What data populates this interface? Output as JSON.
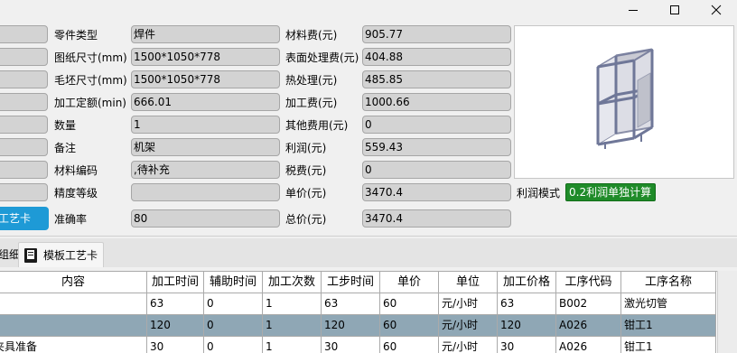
{
  "window": {
    "minimize_glyph": "minimize",
    "maximize_glyph": "maximize",
    "close_glyph": "close"
  },
  "form": {
    "left_labels": [
      "零件类型",
      "图纸尺寸(mm)",
      "毛坯尺寸(mm)",
      "加工定额(min)",
      "数量",
      "备注",
      "材料编码",
      "精度等级",
      "准确率"
    ],
    "left_values": [
      "焊件",
      "1500*1050*778",
      "1500*1050*778",
      "666.01",
      "1",
      "机架",
      ",待补充",
      "",
      "80"
    ],
    "right_labels": [
      "材料费(元)",
      "表面处理费(元)",
      "热处理(元)",
      "加工费(元)",
      "其他费用(元)",
      "利润(元)",
      "税费(元)",
      "单价(元)",
      "总价(元)"
    ],
    "right_values": [
      "905.77",
      "404.88",
      "485.85",
      "1000.66",
      "0",
      "559.43",
      "0",
      "3470.4",
      "3470.4"
    ],
    "profit_mode_label": "利润模式",
    "profit_mode_value": "0.2利润单独计算",
    "process_card_button": "易工艺卡"
  },
  "tabs": {
    "left_partial": "组细",
    "template_card": "模板工艺卡"
  },
  "table": {
    "columns": [
      "内容",
      "加工时间",
      "辅助时间",
      "加工次数",
      "工步时间",
      "单价",
      "单位",
      "加工价格",
      "工序代码",
      "工序名称"
    ],
    "rows": [
      [
        "",
        "63",
        "0",
        "1",
        "63",
        "60",
        "元/小时",
        "63",
        "B002",
        "激光切管"
      ],
      [
        "",
        "120",
        "0",
        "1",
        "120",
        "60",
        "元/小时",
        "120",
        "A026",
        "钳工1"
      ],
      [
        "夹具准备",
        "30",
        "0",
        "1",
        "30",
        "60",
        "元/小时",
        "30",
        "A026",
        "钳工1"
      ]
    ],
    "selected_row": 1
  },
  "colors": {
    "accent_blue": "#1e9ad6",
    "profit_green": "#1f8b29",
    "selected_row": "#8fa7b5"
  }
}
